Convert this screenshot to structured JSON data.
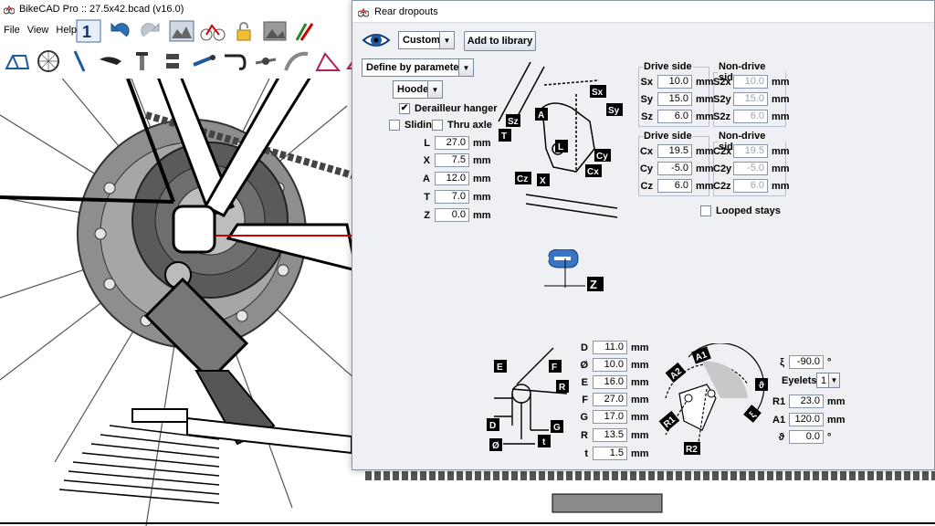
{
  "app": {
    "title": "BikeCAD Pro :: 27.5x42.bcad (v16.0)"
  },
  "menu": {
    "items": [
      "File",
      "View",
      "Help"
    ]
  },
  "dialog": {
    "title": "Rear dropouts",
    "preset": "Custom",
    "add_library_label": "Add to library",
    "define_mode": "Define by parameters",
    "dropout_type": "Hooded",
    "derailleur_hanger_label": "Derailleur hanger",
    "derailleur_hanger_checked": true,
    "sliding_label": "Sliding",
    "sliding_checked": false,
    "thru_axle_label": "Thru axle",
    "thru_axle_checked": false,
    "unit": "mm",
    "degree": "°",
    "params": [
      {
        "label": "L",
        "value": "27.0"
      },
      {
        "label": "X",
        "value": "7.5"
      },
      {
        "label": "A",
        "value": "12.0"
      },
      {
        "label": "T",
        "value": "7.0"
      },
      {
        "label": "Z",
        "value": "0.0"
      }
    ],
    "drive_side_s": {
      "title": "Drive side",
      "rows": [
        {
          "label": "Sx",
          "value": "10.0"
        },
        {
          "label": "Sy",
          "value": "15.0"
        },
        {
          "label": "Sz",
          "value": "6.0"
        }
      ]
    },
    "non_drive_side_s": {
      "title": "Non-drive side",
      "rows": [
        {
          "label": "S2x",
          "value": "10.0"
        },
        {
          "label": "S2y",
          "value": "15.0"
        },
        {
          "label": "S2z",
          "value": "6.0"
        }
      ]
    },
    "drive_side_c": {
      "title": "Drive side",
      "rows": [
        {
          "label": "Cx",
          "value": "19.5"
        },
        {
          "label": "Cy",
          "value": "-5.0"
        },
        {
          "label": "Cz",
          "value": "6.0"
        }
      ]
    },
    "non_drive_side_c": {
      "title": "Non-drive side",
      "rows": [
        {
          "label": "C2x",
          "value": "19.5"
        },
        {
          "label": "C2y",
          "value": "-5.0"
        },
        {
          "label": "C2z",
          "value": "6.0"
        }
      ]
    },
    "looped_stays_label": "Looped stays",
    "looped_stays_checked": false,
    "bottom_params": [
      {
        "label": "D",
        "value": "11.0"
      },
      {
        "label": "Ø",
        "value": "10.0"
      },
      {
        "label": "E",
        "value": "16.0"
      },
      {
        "label": "F",
        "value": "27.0"
      },
      {
        "label": "G",
        "value": "17.0"
      },
      {
        "label": "R",
        "value": "13.5"
      },
      {
        "label": "t",
        "value": "1.5"
      }
    ],
    "xi": {
      "label": "ξ",
      "value": "-90.0"
    },
    "eyelets": {
      "label": "Eyelets",
      "value": "1"
    },
    "r1": {
      "label": "R1",
      "value": "23.0"
    },
    "a1": {
      "label": "A1",
      "value": "120.0"
    },
    "theta": {
      "label": "ϑ",
      "value": "0.0"
    },
    "diagram_labels": {
      "top": [
        "Sx",
        "Sy",
        "Sz",
        "A",
        "L",
        "T",
        "Cy",
        "Cx",
        "Cz",
        "X"
      ],
      "mid": [
        "Z"
      ],
      "bl": [
        "E",
        "F",
        "R",
        "D",
        "G",
        "Ø",
        "t"
      ],
      "br": [
        "A1",
        "A2",
        "ϑ",
        "ξ",
        "R1",
        "R2"
      ]
    }
  },
  "colors": {
    "accent_red": "#cc0000",
    "dialog_bg": "#eef0f3"
  }
}
